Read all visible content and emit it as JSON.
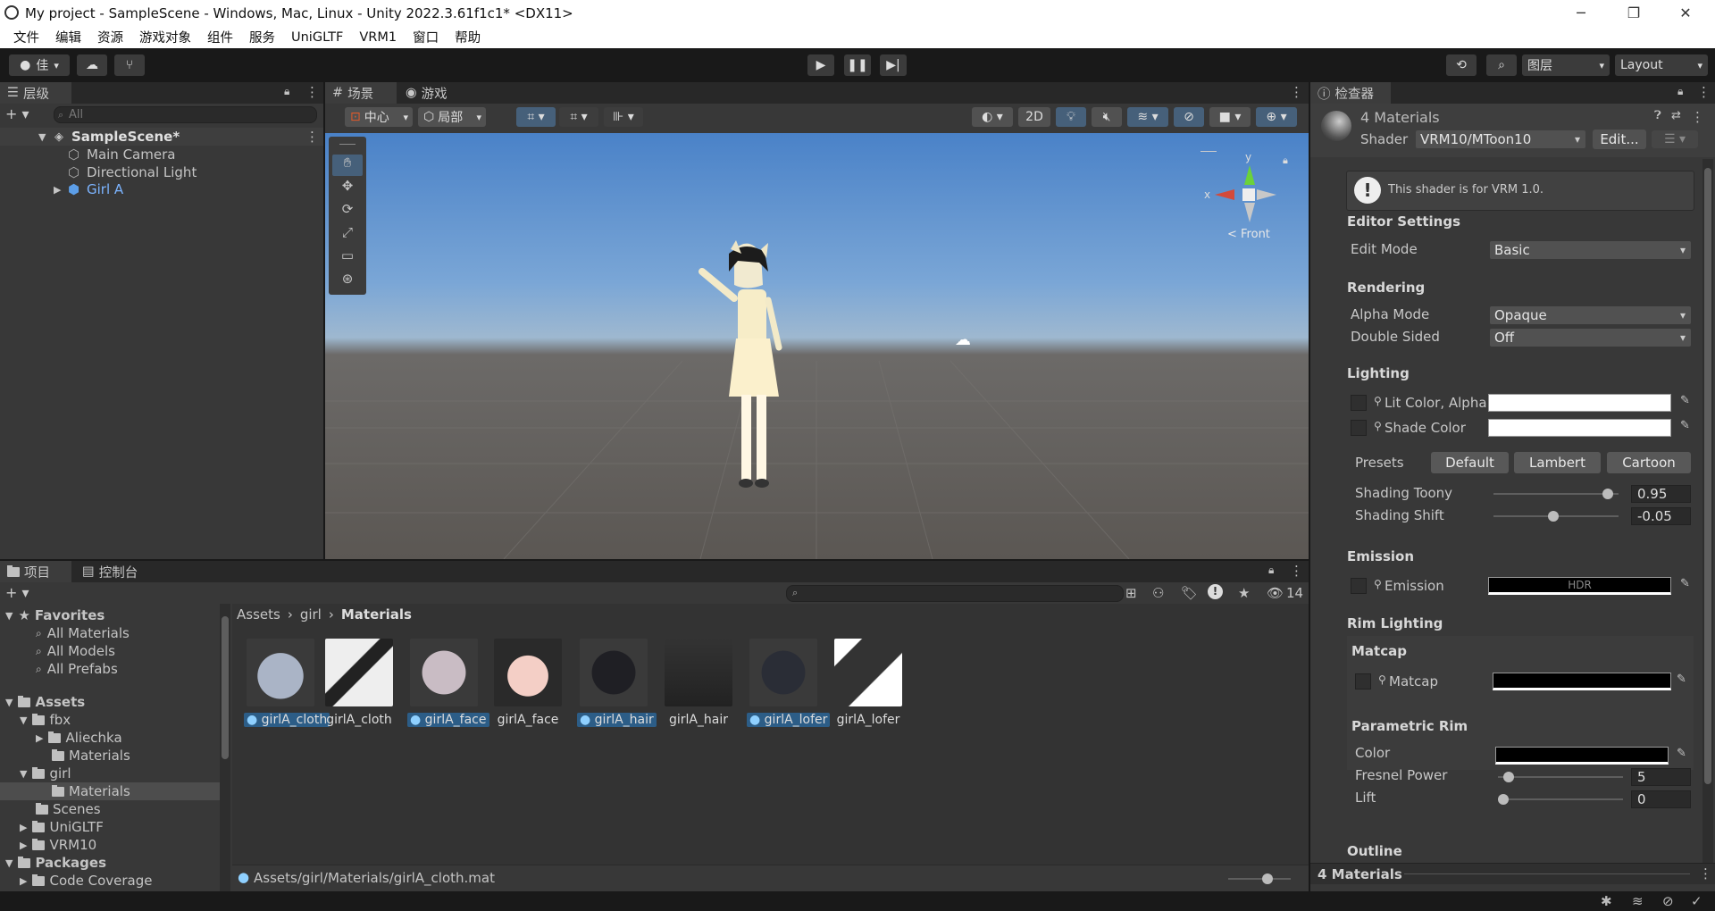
{
  "window": {
    "title": "My project - SampleScene - Windows, Mac, Linux - Unity 2022.3.61f1c1* <DX11>"
  },
  "menu": [
    "文件",
    "编辑",
    "资源",
    "游戏对象",
    "组件",
    "服务",
    "UniGLTF",
    "VRM1",
    "窗口",
    "帮助"
  ],
  "toolbar": {
    "account_label": "佳",
    "layers_label": "图层",
    "layout_label": "Layout"
  },
  "hierarchy": {
    "tab": "层级",
    "search_placeholder": "All",
    "scene": "SampleScene*",
    "items": [
      "Main Camera",
      "Directional Light",
      "Girl A"
    ]
  },
  "scene_view": {
    "tabs": [
      "场景",
      "游戏"
    ],
    "pivot": "中心",
    "space": "局部",
    "mode_2d": "2D",
    "gizmo_front": "< Front",
    "gizmo_x": "x",
    "gizmo_y": "y"
  },
  "inspector": {
    "tab": "检查器",
    "title": "4 Materials",
    "shader_label": "Shader",
    "shader_value": "VRM10/MToon10",
    "edit_button": "Edit...",
    "notice": "This shader is for VRM 1.0.",
    "editor_settings": "Editor Settings",
    "edit_mode_label": "Edit Mode",
    "edit_mode_value": "Basic",
    "rendering": "Rendering",
    "alpha_mode_label": "Alpha Mode",
    "alpha_mode_value": "Opaque",
    "double_sided_label": "Double Sided",
    "double_sided_value": "Off",
    "lighting": "Lighting",
    "lit_color_label": "Lit Color, Alpha",
    "shade_color_label": "Shade Color",
    "presets_label": "Presets",
    "preset_buttons": [
      "Default",
      "Lambert",
      "Cartoon"
    ],
    "shading_toony_label": "Shading Toony",
    "shading_toony_value": "0.95",
    "shading_toony_level": 0.95,
    "shading_shift_label": "Shading Shift",
    "shading_shift_value": "-0.05",
    "shading_shift_level": 0.475,
    "emission": "Emission",
    "emission_label": "Emission",
    "hdr": "HDR",
    "rim_lighting": "Rim Lighting",
    "matcap_header": "Matcap",
    "matcap_label": "Matcap",
    "parametric_rim": "Parametric Rim",
    "color_label": "Color",
    "fresnel_label": "Fresnel Power",
    "fresnel_value": "5",
    "fresnel_level": 0.05,
    "lift_label": "Lift",
    "lift_value": "0",
    "lift_level": 0.0,
    "outline": "Outline",
    "footer": "4 Materials"
  },
  "project": {
    "tabs": [
      "项目",
      "控制台"
    ],
    "eye_count": "14",
    "tree": [
      "Favorites",
      "All Materials",
      "All Models",
      "All Prefabs",
      "Assets",
      "fbx",
      "Aliechka",
      "Materials",
      "girl",
      "Materials",
      "Scenes",
      "UniGLTF",
      "VRM10",
      "Packages",
      "Code Coverage"
    ],
    "breadcrumb": [
      "Assets",
      "girl",
      "Materials"
    ],
    "assets": [
      "girlA_cloth",
      "girlA_cloth",
      "girlA_face",
      "girlA_face",
      "girlA_hair",
      "girlA_hair",
      "girlA_lofer",
      "girlA_lofer"
    ],
    "status_path": "Assets/girl/Materials/girlA_cloth.mat"
  },
  "colors": {
    "accent": "#2c5d87",
    "selected_row": "#4d4d4d",
    "panel": "#383838",
    "blue_text": "#7cb4ff"
  }
}
